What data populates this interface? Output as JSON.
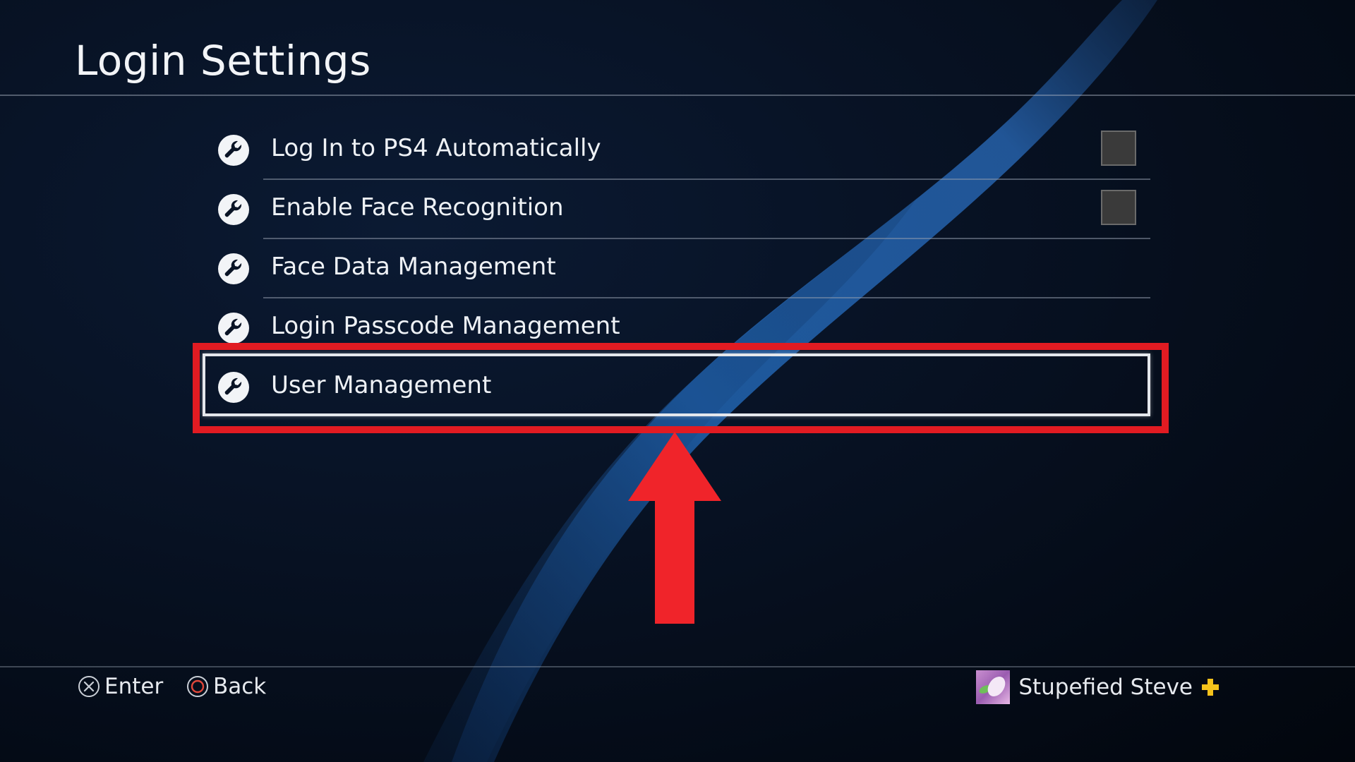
{
  "screen": {
    "title": "Login Settings"
  },
  "menu": {
    "items": [
      {
        "label": "Log In to PS4 Automatically",
        "icon": "wrench-icon",
        "has_checkbox": true,
        "checked": false
      },
      {
        "label": "Enable Face Recognition",
        "icon": "wrench-icon",
        "has_checkbox": true,
        "checked": false
      },
      {
        "label": "Face Data Management",
        "icon": "wrench-icon",
        "has_checkbox": false
      },
      {
        "label": "Login Passcode Management",
        "icon": "wrench-icon",
        "has_checkbox": false
      },
      {
        "label": "User Management",
        "icon": "wrench-icon",
        "has_checkbox": false,
        "focused": true
      }
    ]
  },
  "annotation": {
    "highlight_color": "#e11b22",
    "arrow_direction": "up"
  },
  "footer": {
    "hints": [
      {
        "button": "cross-button-icon",
        "label": "Enter"
      },
      {
        "button": "circle-button-icon",
        "label": "Back"
      }
    ],
    "user": {
      "name": "Stupefied Steve",
      "badge": "ps-plus-icon"
    }
  },
  "colors": {
    "background": "#02060d",
    "wave": "#1f5fa8",
    "text": "#eef1f5",
    "checkbox": "#3a3a3a",
    "ps_plus": "#f5c21b"
  }
}
